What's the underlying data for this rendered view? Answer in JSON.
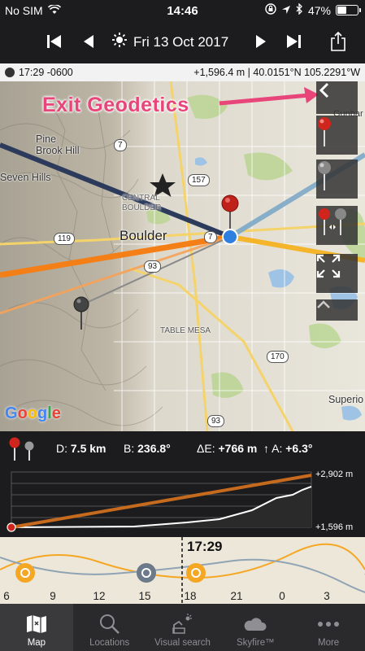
{
  "status": {
    "carrier": "No SIM",
    "time": "14:46",
    "battery": "47%",
    "battery_level": 0.47
  },
  "toolbar": {
    "date": "Fri 13 Oct 2017"
  },
  "infobar": {
    "time_tz": "17:29 -0600",
    "position": "+1,596.4 m | 40.0151°N 105.2291°W"
  },
  "map": {
    "annotation": "Exit Geodetics",
    "labels": {
      "pine_brook_hill": "Pine\nBrook Hill",
      "seven_hills": "Seven Hills",
      "central_boulder": "CENTRAL\nBOULDER",
      "boulder": "Boulder",
      "table_mesa": "TABLE MESA",
      "superior": "Superio",
      "gunbarrel": "Gunbar"
    },
    "roads": {
      "r7a": "7",
      "r157": "157",
      "r119": "119",
      "r7b": "7",
      "r93a": "93",
      "r170": "170",
      "r93b": "93"
    },
    "attribution": "Google"
  },
  "measure": {
    "distance_label": "D:",
    "distance": "7.5 km",
    "bearing_label": "B:",
    "bearing": "236.8°",
    "elev_label": "ΔE:",
    "elev": "+766 m",
    "alt_label": "A:",
    "alt": "+6.3°"
  },
  "profile": {
    "top_label": "+2,902 m",
    "bottom_label": "+1,596 m"
  },
  "timeline": {
    "current_time": "17:29",
    "hours": [
      "6",
      "9",
      "12",
      "15",
      "18",
      "21",
      "0",
      "3"
    ]
  },
  "tabs": [
    {
      "label": "Map",
      "icon": "map-icon"
    },
    {
      "label": "Locations",
      "icon": "search-icon"
    },
    {
      "label": "Visual search",
      "icon": "visual-search-icon"
    },
    {
      "label": "Skyfire™",
      "icon": "cloud-icon"
    },
    {
      "label": "More",
      "icon": "more-icon"
    }
  ],
  "colors": {
    "accent_pink": "#e8457a",
    "sun_orange": "#f5a623",
    "moon_gray": "#6c7a89",
    "profile_orange": "#c66a1e"
  }
}
